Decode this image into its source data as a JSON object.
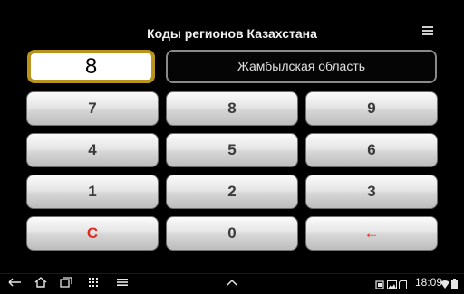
{
  "app": {
    "title": "Коды регионов Казахстана",
    "menu_icon": "overflow-menu-icon"
  },
  "display": {
    "code": "8",
    "region": "Жамбылская область",
    "highlight_color": "#b8941e"
  },
  "keypad": {
    "rows": [
      [
        "7",
        "8",
        "9"
      ],
      [
        "4",
        "5",
        "6"
      ],
      [
        "1",
        "2",
        "3"
      ],
      [
        "C",
        "0",
        "←"
      ]
    ],
    "clear_color": "#e12b1e"
  },
  "status_bar": {
    "time": "18:09",
    "nav_icons": [
      "back-icon",
      "home-icon",
      "recent-apps-icon",
      "screenshot-icon",
      "menu-icon",
      "up-arrow-icon"
    ],
    "status_icons": [
      "notification-icon",
      "photo-icon",
      "storage-icon",
      "wifi-icon",
      "battery-icon"
    ]
  }
}
